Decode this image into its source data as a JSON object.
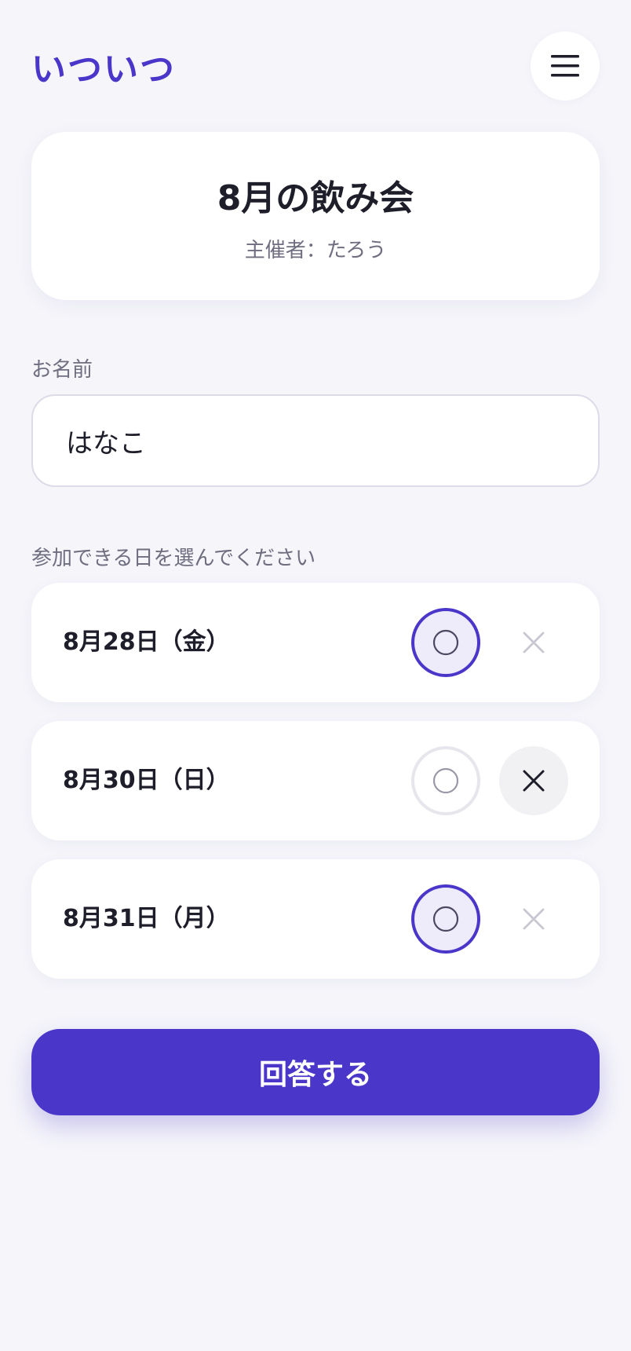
{
  "app": {
    "logo": "いついつ"
  },
  "header": {
    "menu_icon": "menu-icon"
  },
  "event": {
    "title": "8月の飲み会",
    "host": "主催者：たろう"
  },
  "form": {
    "name_label": "お名前",
    "name_value": "はなこ",
    "dates_label": "参加できる日を選んでください",
    "dates": [
      {
        "label": "8月28日（金）",
        "selection": "yes"
      },
      {
        "label": "8月30日（日）",
        "selection": "no"
      },
      {
        "label": "8月31日（月）",
        "selection": "yes"
      }
    ],
    "submit_label": "回答する"
  },
  "colors": {
    "accent": "#4a36c9",
    "background": "#f5f5fa",
    "text": "#1e1e2a",
    "muted": "#6f6e80"
  }
}
